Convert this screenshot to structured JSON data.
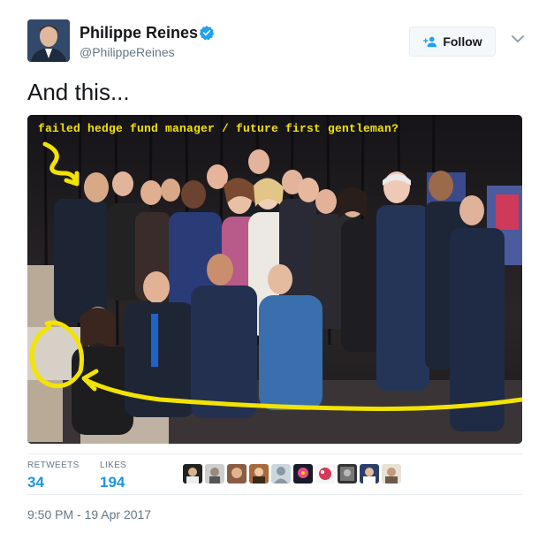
{
  "author": {
    "name": "Philippe Reines",
    "handle": "@PhilippeReines",
    "verified": true
  },
  "follow_button": {
    "label": "Follow",
    "icon": "person-add-icon"
  },
  "tweet": {
    "text": "And this...",
    "photo": {
      "caption": "failed hedge fund manager / future first gentleman?",
      "annotation_color": "#f3e300"
    }
  },
  "stats": {
    "retweets_label": "RETWEETS",
    "retweets": "34",
    "likes_label": "LIKES",
    "likes": "194",
    "likers_count": 10
  },
  "timestamp": "9:50 PM - 19 Apr 2017",
  "colors": {
    "link": "#1b95e0",
    "secondary": "#657786",
    "border": "#e6ecf0",
    "verified": "#1da1f2"
  }
}
